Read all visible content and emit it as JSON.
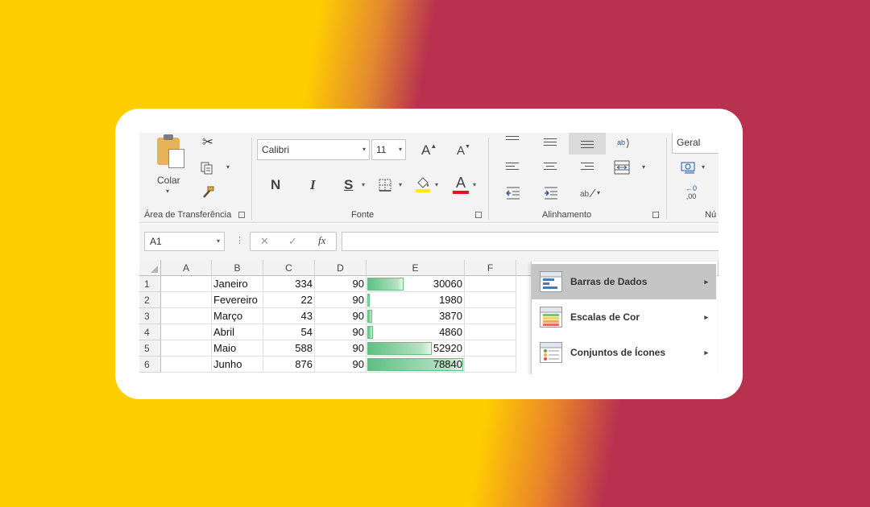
{
  "clipboard": {
    "paste_label": "Colar",
    "group_label": "Área de Transferência"
  },
  "font": {
    "font_name": "Calibri",
    "font_size": "11",
    "bold_label": "N",
    "italic_label": "I",
    "underline_label": "S",
    "grow_label": "A",
    "shrink_label": "A",
    "font_color_label": "A",
    "group_label": "Fonte",
    "font_color": "#e81123",
    "highlight_color": "#ffea00"
  },
  "alignment": {
    "group_label": "Alinhamento"
  },
  "number": {
    "format": "Geral",
    "group_label": "Nú",
    "decimal_label": ",00"
  },
  "formula_bar": {
    "name_box": "A1",
    "fx_label": "fx",
    "cancel_label": "✕",
    "confirm_label": "✓",
    "formula": ""
  },
  "sheet": {
    "columns": [
      "A",
      "B",
      "C",
      "D",
      "E",
      "F"
    ],
    "rows": [
      {
        "num": "1",
        "month": "Janeiro",
        "c": "334",
        "d": "90",
        "e": "30060",
        "fill": 0.381
      },
      {
        "num": "2",
        "month": "Fevereiro",
        "c": "22",
        "d": "90",
        "e": "1980",
        "fill": 0.025
      },
      {
        "num": "3",
        "month": "Março",
        "c": "43",
        "d": "90",
        "e": "3870",
        "fill": 0.049
      },
      {
        "num": "4",
        "month": "Abril",
        "c": "54",
        "d": "90",
        "e": "4860",
        "fill": 0.062
      },
      {
        "num": "5",
        "month": "Maio",
        "c": "588",
        "d": "90",
        "e": "52920",
        "fill": 0.671
      },
      {
        "num": "6",
        "month": "Junho",
        "c": "876",
        "d": "90",
        "e": "78840",
        "fill": 1.0
      }
    ]
  },
  "menu": {
    "items": [
      {
        "label": "Barras de Dados",
        "icon": "data-bars-icon",
        "active": true
      },
      {
        "label": "Escalas de Cor",
        "icon": "color-scales-icon",
        "active": false
      },
      {
        "label": "Conjuntos de Ícones",
        "icon": "icon-sets-icon",
        "active": false
      }
    ]
  }
}
